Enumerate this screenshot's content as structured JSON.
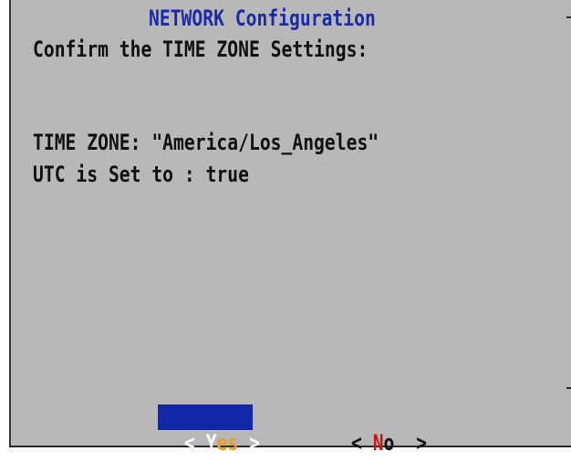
{
  "dialog": {
    "title": "NETWORK Configuration",
    "prompt": "Confirm the TIME ZONE Settings:",
    "time_zone_line": "TIME ZONE: \"America/Los_Angeles\"",
    "utc_line": "UTC is Set to : true"
  },
  "buttons": {
    "yes": {
      "open": "< ",
      "hotkey": "Y",
      "rest": "es",
      "close": " >"
    },
    "no": {
      "open": "< ",
      "hotkey": "N",
      "rest": "o",
      "close": "  >"
    }
  },
  "colors": {
    "dialog_background": "#b8b8b8",
    "title": "#1a2aa8",
    "selected_button_background": "#1228a8",
    "hotkey_highlight": "#c81818",
    "selected_label": "#e8a020"
  }
}
